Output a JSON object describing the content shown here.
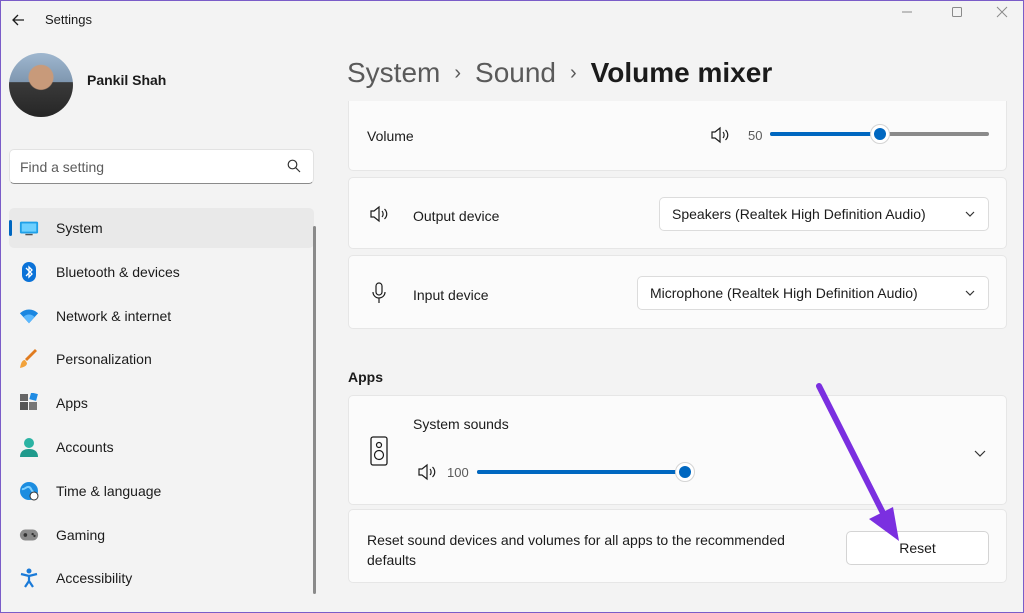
{
  "window": {
    "title": "Settings"
  },
  "user": {
    "name": "Pankil Shah"
  },
  "search": {
    "placeholder": "Find a setting"
  },
  "sidebar": {
    "items": [
      {
        "label": "System",
        "icon": "monitor-icon",
        "active": true
      },
      {
        "label": "Bluetooth & devices",
        "icon": "bluetooth-icon"
      },
      {
        "label": "Network & internet",
        "icon": "wifi-icon"
      },
      {
        "label": "Personalization",
        "icon": "brush-icon"
      },
      {
        "label": "Apps",
        "icon": "apps-icon"
      },
      {
        "label": "Accounts",
        "icon": "person-icon"
      },
      {
        "label": "Time & language",
        "icon": "globe-clock-icon"
      },
      {
        "label": "Gaming",
        "icon": "gamepad-icon"
      },
      {
        "label": "Accessibility",
        "icon": "accessibility-icon"
      }
    ]
  },
  "breadcrumb": {
    "items": [
      "System",
      "Sound",
      "Volume mixer"
    ]
  },
  "volume": {
    "label": "Volume",
    "value": "50",
    "level": 50
  },
  "output": {
    "label": "Output device",
    "selected": "Speakers (Realtek High Definition Audio)"
  },
  "input": {
    "label": "Input device",
    "selected": "Microphone (Realtek High Definition Audio)"
  },
  "apps": {
    "title": "Apps",
    "system_sounds": {
      "label": "System sounds",
      "value": "100",
      "level": 100
    }
  },
  "reset": {
    "description": "Reset sound devices and volumes for all apps to the recommended defaults",
    "button_label": "Reset"
  },
  "colors": {
    "accent": "#0067c0",
    "annotation_arrow": "#7b2fe0"
  }
}
